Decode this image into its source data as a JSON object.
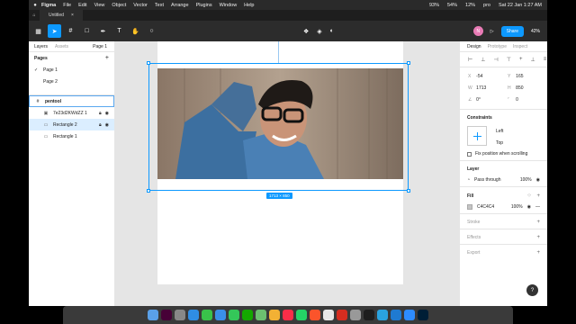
{
  "menubar": {
    "apple": "",
    "menus": [
      "Figma",
      "File",
      "Edit",
      "View",
      "Object",
      "Vector",
      "Text",
      "Arrange",
      "Plugins",
      "Window",
      "Help"
    ],
    "status": [
      "93%",
      "54%",
      "12%",
      "pro",
      "Sat 22 Jan 1:27 AM"
    ]
  },
  "tabs": {
    "home_icon": "home-icon",
    "file_tab": "Untitled",
    "close": "×"
  },
  "toolbar": {
    "share_label": "Share",
    "avatar_initial": "N",
    "zoom": "42%",
    "tools": [
      "main-menu",
      "move",
      "frame",
      "shape",
      "pen",
      "text",
      "hand",
      "comment"
    ]
  },
  "left_panel": {
    "tab_layers": "Layers",
    "tab_assets": "Assets",
    "page_selector": "Page 1",
    "pages_title": "Pages",
    "pages": [
      {
        "name": "Page 1",
        "current": true
      },
      {
        "name": "Page 2",
        "current": false
      }
    ],
    "frame_name": "pentool",
    "layers": [
      {
        "name": "7e23d2KWdZZ 1",
        "selected": false,
        "locked": true
      },
      {
        "name": "Rectangle 2",
        "selected": true,
        "locked": true
      },
      {
        "name": "Rectangle 1",
        "selected": false,
        "locked": false
      }
    ]
  },
  "canvas": {
    "size_tag": "1713 × 850",
    "help": "?"
  },
  "right_panel": {
    "tab_design": "Design",
    "tab_prototype": "Prototype",
    "tab_inspect": "Inspect",
    "x_label": "X",
    "x": "-54",
    "y_label": "Y",
    "y": "165",
    "w_label": "W",
    "w": "1713",
    "h_label": "H",
    "h": "850",
    "rotation": "0°",
    "radius": "0",
    "constraints_title": "Constraints",
    "constraint_h": "Left",
    "constraint_v": "Top",
    "fix_position": "Fix position when scrolling",
    "layer_title": "Layer",
    "blend_mode": "Pass through",
    "layer_opacity": "100%",
    "fill_title": "Fill",
    "fill_hex": "C4C4C4",
    "fill_opacity": "100%",
    "stroke_title": "Stroke",
    "effects_title": "Effects",
    "export_title": "Export"
  },
  "colors": {
    "accent": "#0d99ff",
    "fill_swatch": "#c4c4c4"
  },
  "dock": {
    "apps": [
      "finder",
      "adobe-xd",
      "launchpad",
      "safari",
      "messages",
      "mail",
      "facetime",
      "upwork",
      "maps",
      "photos",
      "music",
      "whatsapp",
      "brave",
      "chrome",
      "vpn",
      "screenshot",
      "figma",
      "telegram",
      "vscode",
      "zoom",
      "photoshop"
    ]
  }
}
